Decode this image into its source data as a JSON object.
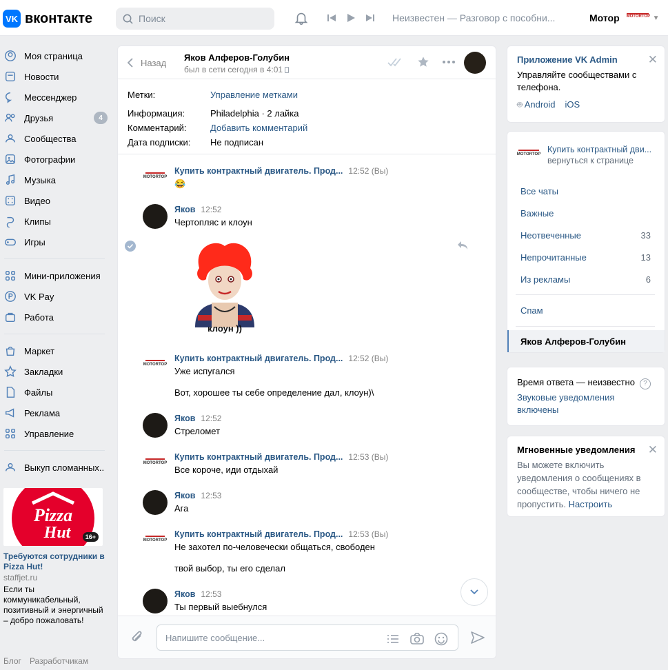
{
  "header": {
    "logo_text": "вконтакте",
    "search_placeholder": "Поиск",
    "now_playing": "Неизвестен — Разговор с пособни...",
    "user_name": "Мотор"
  },
  "sidebar": {
    "items": [
      {
        "label": "Моя страница",
        "icon": "user-circle-icon"
      },
      {
        "label": "Новости",
        "icon": "news-icon"
      },
      {
        "label": "Мессенджер",
        "icon": "message-icon"
      },
      {
        "label": "Друзья",
        "icon": "friends-icon",
        "count": "4"
      },
      {
        "label": "Сообщества",
        "icon": "communities-icon"
      },
      {
        "label": "Фотографии",
        "icon": "photo-icon"
      },
      {
        "label": "Музыка",
        "icon": "music-icon"
      },
      {
        "label": "Видео",
        "icon": "video-icon"
      },
      {
        "label": "Клипы",
        "icon": "clips-icon"
      },
      {
        "label": "Игры",
        "icon": "games-icon"
      }
    ],
    "items2": [
      {
        "label": "Мини-приложения",
        "icon": "apps-icon"
      },
      {
        "label": "VK Pay",
        "icon": "vkpay-icon"
      },
      {
        "label": "Работа",
        "icon": "work-icon"
      }
    ],
    "items3": [
      {
        "label": "Маркет",
        "icon": "market-icon"
      },
      {
        "label": "Закладки",
        "icon": "bookmark-icon"
      },
      {
        "label": "Файлы",
        "icon": "file-icon"
      },
      {
        "label": "Реклама",
        "icon": "ads-icon"
      },
      {
        "label": "Управление",
        "icon": "manage-icon"
      }
    ],
    "items4": [
      {
        "label": "Выкуп сломанных..",
        "icon": "community-icon"
      }
    ],
    "ad": {
      "badge": "16+",
      "title": "Требуются сотрудники в Pizza Hut!",
      "domain": "staffjet.ru",
      "text": "Если ты коммуникабельный, позитивный и энергичный – добро пожаловать!"
    },
    "footer": [
      "Блог",
      "Разработчикам"
    ]
  },
  "chat": {
    "back_label": "Назад",
    "peer_name": "Яков Алферов-Голубин",
    "peer_status": "был в сети сегодня в 4:01",
    "info": [
      {
        "key": "Метки:",
        "value": "Управление метками",
        "link": true
      },
      {
        "key": "Информация:",
        "value": "Philadelphia · 2 лайка",
        "link": false
      },
      {
        "key": "Комментарий:",
        "value": "Добавить комментарий",
        "link": true
      },
      {
        "key": "Дата подписки:",
        "value": "Не подписан",
        "link": false
      }
    ],
    "messages": [
      {
        "author": "Купить контрактный двигатель. Прод...",
        "time": "12:52 (Вы)",
        "text": "😂"
      },
      {
        "author": "Яков",
        "time": "12:52",
        "text": "Чертопляс и клоун"
      },
      {
        "author": "Купить контрактный двигатель. Прод...",
        "time": "12:52 (Вы)",
        "text": "Уже испугался",
        "text2": "Вот, хорошее ты себе определение дал, клоун)\\"
      },
      {
        "author": "Яков",
        "time": "12:52",
        "text": "Стреломет"
      },
      {
        "author": "Купить контрактный двигатель. Прод...",
        "time": "12:53 (Вы)",
        "text": "Все короче, иди отдыхай"
      },
      {
        "author": "Яков",
        "time": "12:53",
        "text": "Ага"
      },
      {
        "author": "Купить контрактный двигатель. Прод...",
        "time": "12:53 (Вы)",
        "text": "Не захотел по-человечески общаться, свободен",
        "text2": "твой выбор, ты его сделал"
      },
      {
        "author": "Яков",
        "time": "12:53",
        "text": "Ты первый выебнулся"
      }
    ],
    "sticker_caption": "клоун ))",
    "compose_placeholder": "Напишите сообщение..."
  },
  "right": {
    "admin": {
      "title": "Приложение VK Admin",
      "desc": "Управляйте сообществами с телефона.",
      "android": "Android",
      "ios": "iOS"
    },
    "community": {
      "name": "Купить контрактный дви...",
      "back": "вернуться к странице"
    },
    "filters": [
      {
        "label": "Все чаты",
        "count": ""
      },
      {
        "label": "Важные",
        "count": ""
      },
      {
        "label": "Неотвеченные",
        "count": "33"
      },
      {
        "label": "Непрочитанные",
        "count": "13"
      },
      {
        "label": "Из рекламы",
        "count": "6"
      }
    ],
    "spam": "Спам",
    "active_chat": "Яков Алферов-Голубин",
    "response": {
      "title": "Время ответа — неизвестно",
      "link": "Звуковые уведомления включены"
    },
    "instant": {
      "title": "Мгновенные уведомления",
      "desc": "Вы можете включить уведомления о сообщениях в сообществе, чтобы ничего не пропустить.",
      "link": "Настроить"
    }
  }
}
